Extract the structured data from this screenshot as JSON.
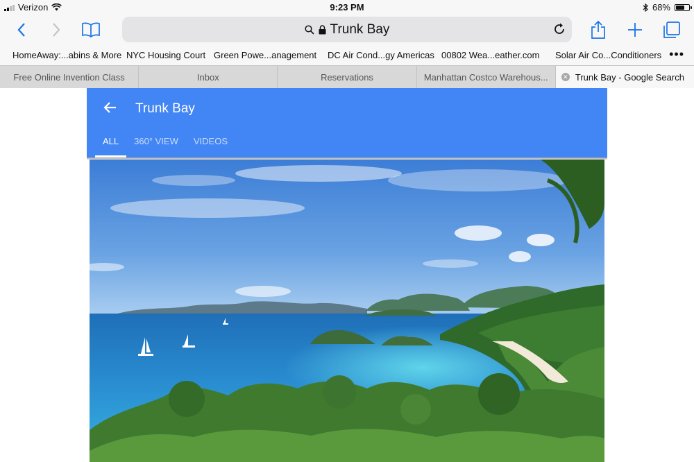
{
  "status_bar": {
    "carrier": "Verizon",
    "time": "9:23 PM",
    "battery_percent": "68%",
    "battery_level": 0.68,
    "icons": [
      "signal-bars-icon",
      "wifi-icon",
      "bluetooth-icon",
      "battery-icon"
    ]
  },
  "toolbar": {
    "address_text": "Trunk Bay",
    "icons": [
      "back-icon",
      "forward-icon",
      "bookmarks-book-icon",
      "search-icon",
      "lock-icon",
      "reload-icon",
      "share-icon",
      "new-tab-plus-icon",
      "tabs-overview-icon"
    ],
    "accent_color": "#1a73e8"
  },
  "bookmarks": [
    {
      "label": "HomeAway:...abins & More"
    },
    {
      "label": "NYC Housing Court"
    },
    {
      "label": "Green Powe...anagement"
    },
    {
      "label": "DC Air Cond...gy Americas"
    },
    {
      "label": "00802 Wea...eather.com"
    },
    {
      "label": "Solar Air Co...Conditioners"
    }
  ],
  "bookmarks_more": "•••",
  "tabs": [
    {
      "label": "Free Online Invention Class",
      "active": false
    },
    {
      "label": "Inbox",
      "active": false
    },
    {
      "label": "Reservations",
      "active": false
    },
    {
      "label": "Manhattan Costco Warehous...",
      "active": false
    },
    {
      "label": "Trunk Bay - Google Search",
      "active": true
    }
  ],
  "panel": {
    "title": "Trunk Bay",
    "tabs": [
      {
        "label": "ALL",
        "active": true
      },
      {
        "label": "360° VIEW",
        "active": false
      },
      {
        "label": "VIDEOS",
        "active": false
      }
    ],
    "color": "#4285f4"
  },
  "image": {
    "icon": "photo-image",
    "subject": "beach-bay-photo"
  }
}
